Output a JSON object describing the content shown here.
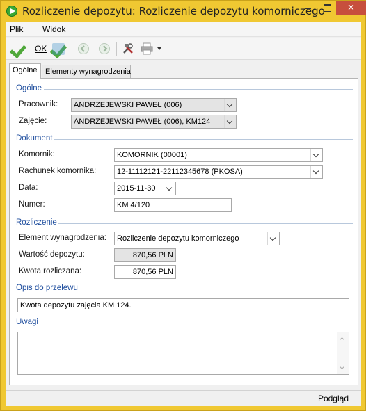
{
  "window": {
    "title": "Rozliczenie depozytu: Rozliczenie depozytu komorniczego",
    "close_glyph": "✕"
  },
  "menu": {
    "items": [
      {
        "label": "Plik"
      },
      {
        "label": "Widok"
      }
    ]
  },
  "toolbar": {
    "ok_label": "OK",
    "icons": [
      "ok-check-icon",
      "apply-check-icon",
      "back-arrow-icon",
      "forward-arrow-icon",
      "tools-icon",
      "print-icon",
      "dropdown-arrow-icon"
    ]
  },
  "tabs": [
    {
      "label": "Ogólne",
      "active": true
    },
    {
      "label": "Elementy wynagrodzenia",
      "active": false
    }
  ],
  "sections": {
    "ogolne": {
      "title": "Ogólne",
      "pracownik_label": "Pracownik:",
      "pracownik_value": "ANDRZEJEWSKI PAWEŁ (006)",
      "zajecie_label": "Zajęcie:",
      "zajecie_value": "ANDRZEJEWSKI PAWEŁ (006), KM124"
    },
    "dokument": {
      "title": "Dokument",
      "komornik_label": "Komornik:",
      "komornik_value": "KOMORNIK (00001)",
      "rachunek_label": "Rachunek komornika:",
      "rachunek_value": "12-11112121-22112345678 (PKOSA)",
      "data_label": "Data:",
      "data_value": "2015-11-30",
      "numer_label": "Numer:",
      "numer_value": "KM 4/120"
    },
    "rozliczenie": {
      "title": "Rozliczenie",
      "element_label": "Element wynagrodzenia:",
      "element_value": "Rozliczenie depozytu komorniczego",
      "wartosc_label": "Wartość depozytu:",
      "wartosc_value": "870,56 PLN",
      "kwota_label": "Kwota rozliczana:",
      "kwota_value": "870,56 PLN"
    },
    "opis": {
      "title": "Opis do przelewu",
      "value": "Kwota depozytu zajęcia KM 124."
    },
    "uwagi": {
      "title": "Uwagi",
      "value": ""
    }
  },
  "status": {
    "right_text": "Podgląd"
  },
  "colors": {
    "window_frame": "#f0c832",
    "section_title": "#1f4e9e",
    "close_button": "#c74f3d",
    "check_green": "#4fa83a"
  }
}
